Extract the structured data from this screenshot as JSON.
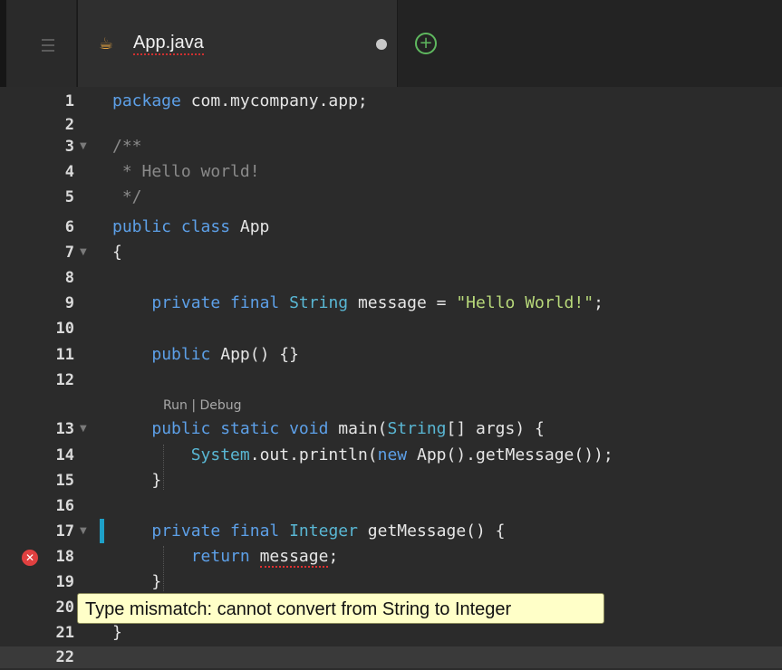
{
  "tabbar": {
    "tab_label": "App.java",
    "tab_icon": "java-icon",
    "new_tab_icon": "plus-circle-icon",
    "menu_icon": "hamburger-menu-icon"
  },
  "editor": {
    "lines": [
      {
        "n": "1",
        "text": "package com.mycompany.app;"
      },
      {
        "n": "2",
        "text": ""
      },
      {
        "n": "3",
        "text": "/**"
      },
      {
        "n": "4",
        "text": " * Hello world!"
      },
      {
        "n": "5",
        "text": " */"
      },
      {
        "n": "6",
        "text": "public class App"
      },
      {
        "n": "7",
        "text": "{"
      },
      {
        "n": "8",
        "text": ""
      },
      {
        "n": "9",
        "text": "    private final String message = \"Hello World!\";"
      },
      {
        "n": "10",
        "text": ""
      },
      {
        "n": "11",
        "text": "    public App() {}"
      },
      {
        "n": "12",
        "text": ""
      },
      {
        "n": "13",
        "text": "    public static void main(String[] args) {"
      },
      {
        "n": "14",
        "text": "        System.out.println(new App().getMessage());"
      },
      {
        "n": "15",
        "text": "    }"
      },
      {
        "n": "16",
        "text": ""
      },
      {
        "n": "17",
        "text": "    private final Integer getMessage() {"
      },
      {
        "n": "18",
        "text": "        return message;"
      },
      {
        "n": "19",
        "text": "    }"
      },
      {
        "n": "20",
        "text": ""
      },
      {
        "n": "21",
        "text": "}"
      },
      {
        "n": "22",
        "text": ""
      }
    ],
    "codelens": {
      "run": "Run",
      "sep": "|",
      "debug": "Debug"
    },
    "error_tooltip": "Type mismatch: cannot convert from String to Integer",
    "error_icon": "error-x-icon"
  },
  "colors": {
    "keyword": "#5da0e8",
    "string": "#b8d97a",
    "comment": "#8a8a8a",
    "error": "#e04040",
    "change_marker": "#1ea0c8",
    "tooltip_bg": "#ffffc8"
  }
}
